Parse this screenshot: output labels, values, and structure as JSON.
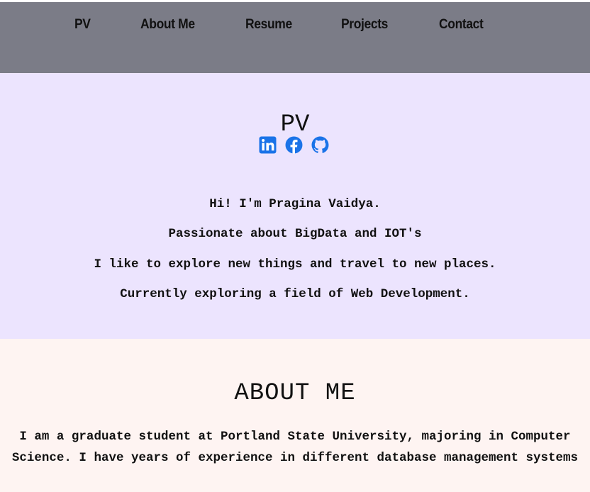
{
  "nav": {
    "items": [
      {
        "label": "PV"
      },
      {
        "label": "About Me"
      },
      {
        "label": "Resume"
      },
      {
        "label": "Projects"
      },
      {
        "label": "Contact"
      }
    ]
  },
  "hero": {
    "title": "PV",
    "social_icons": [
      "linkedin-icon",
      "facebook-icon",
      "github-icon"
    ],
    "icon_color": "#1a73e8",
    "lines": [
      "Hi! I'm Pragina Vaidya.",
      "Passionate about BigData and IOT's",
      "I like to explore new things and travel to new places.",
      "Currently exploring a field of Web Development."
    ]
  },
  "about": {
    "title": "ABOUT ME",
    "text": "I am a graduate student at Portland State University, majoring in Computer Science. I have years of experience in different database management systems"
  },
  "colors": {
    "nav_bg": "#7b7c87",
    "hero_bg": "#ece4fe",
    "about_bg": "#fef4f2",
    "text": "#111111"
  }
}
